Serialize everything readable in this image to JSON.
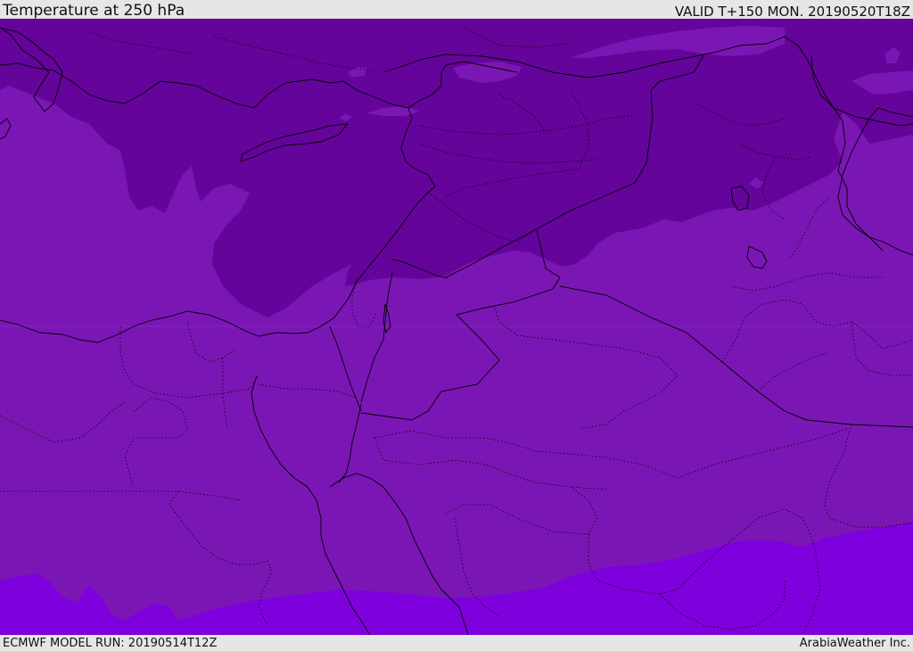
{
  "header": {
    "title": "Temperature at 250 hPa",
    "valid": "VALID T+150 MON. 20190520T18Z"
  },
  "footer": {
    "model_run": "ECMWF MODEL RUN: 20190514T12Z",
    "brand": "ArabiaWeather Inc."
  },
  "map": {
    "colors": {
      "cold_band": "#64049a",
      "mid_band": "#7a17b4",
      "warm_band": "#7e00dc",
      "lines": "#000000"
    }
  }
}
